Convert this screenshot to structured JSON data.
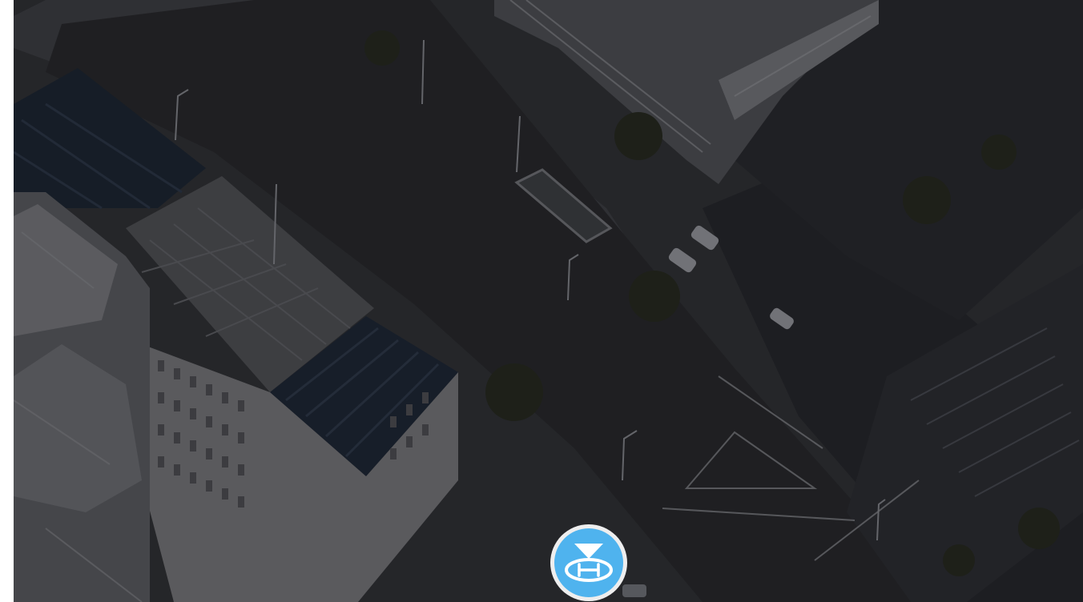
{
  "app": {
    "accent_color": "#4fb3ee",
    "overlay_color": "#000000"
  },
  "camera_view": {
    "feed_label": "aerial-drone-camera-feed",
    "overlay_dimmed": true
  },
  "controls": {
    "landing_button": {
      "icon": "drone-landing-helipad-icon",
      "state": "idle"
    }
  }
}
